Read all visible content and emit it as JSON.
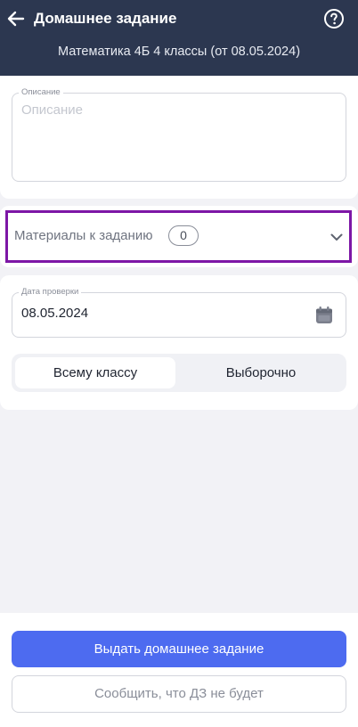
{
  "header": {
    "title": "Домашнее задание",
    "subtitle": "Математика 4Б 4 классы (от 08.05.2024)",
    "back_icon": "arrow-left-icon",
    "help_icon": "question-circle-icon"
  },
  "description": {
    "label": "Описание",
    "placeholder": "Описание",
    "value": ""
  },
  "materials": {
    "label": "Материалы к заданию",
    "count": "0",
    "expand_icon": "chevron-down-icon"
  },
  "check_date": {
    "label": "Дата проверки",
    "value": "08.05.2024",
    "icon": "calendar-icon"
  },
  "assign_to": {
    "options": [
      "Всему классу",
      "Выборочно"
    ],
    "selected": "Всему классу"
  },
  "actions": {
    "primary_label": "Выдать домашнее задание",
    "secondary_label": "Сообщить, что ДЗ не будет"
  },
  "colors": {
    "header_bg": "#2c3750",
    "primary": "#4d6bf0",
    "highlight": "#7d16a6",
    "page_bg": "#f2f2f6"
  }
}
